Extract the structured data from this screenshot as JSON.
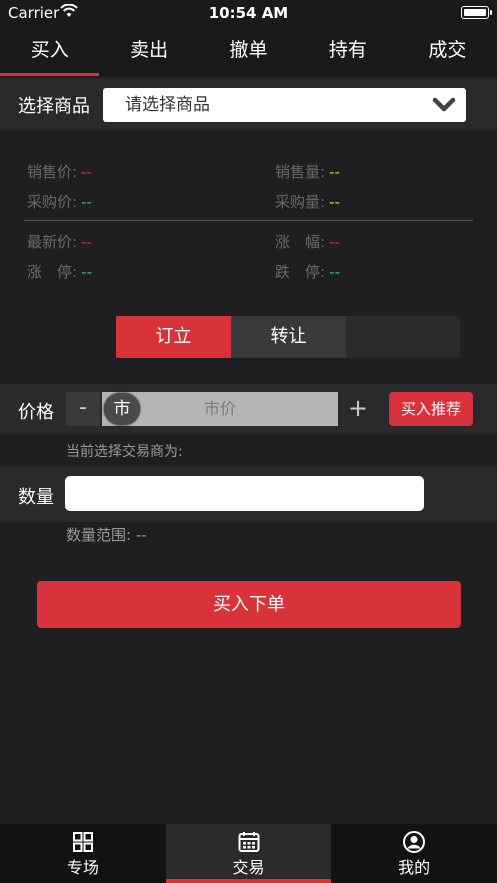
{
  "status_bar": {
    "carrier": "Carrier",
    "time": "10:54 AM"
  },
  "top_tabs": [
    {
      "label": "买入",
      "active": true
    },
    {
      "label": "卖出"
    },
    {
      "label": "撤单"
    },
    {
      "label": "持有"
    },
    {
      "label": "成交"
    }
  ],
  "product": {
    "label": "选择商品",
    "placeholder": "请选择商品"
  },
  "quote": {
    "sell_price_label": "销售价:",
    "sell_price_value": "--",
    "sell_qty_label": "销售量:",
    "sell_qty_value": "--",
    "buy_price_label": "采购价:",
    "buy_price_value": "--",
    "buy_qty_label": "采购量:",
    "buy_qty_value": "--",
    "latest_label": "最新价:",
    "latest_value": "--",
    "change_label": "涨　幅:",
    "change_value": "--",
    "limit_up_label": "涨　停:",
    "limit_up_value": "--",
    "limit_down_label": "跌　停:",
    "limit_down_value": "--"
  },
  "order_type": {
    "option_1": "订立",
    "option_2": "转让"
  },
  "price": {
    "label": "价格",
    "minus": "-",
    "knob": "市",
    "field_text": "市价",
    "plus": "+",
    "recommend": "买入推荐"
  },
  "dealer_text": "当前选择交易商为:",
  "quantity": {
    "label": "数量",
    "value": "",
    "range_text": "数量范围: --"
  },
  "submit_label": "买入下单",
  "bottom_nav": [
    {
      "label": "专场",
      "icon": "grid-icon"
    },
    {
      "label": "交易",
      "icon": "calendar-icon",
      "active": true
    },
    {
      "label": "我的",
      "icon": "user-icon"
    }
  ],
  "colors": {
    "accent": "#d8323a",
    "background": "#1f1f21",
    "panel": "#2a2a2c",
    "down": "#23c15a",
    "volume": "#e4c43a"
  }
}
